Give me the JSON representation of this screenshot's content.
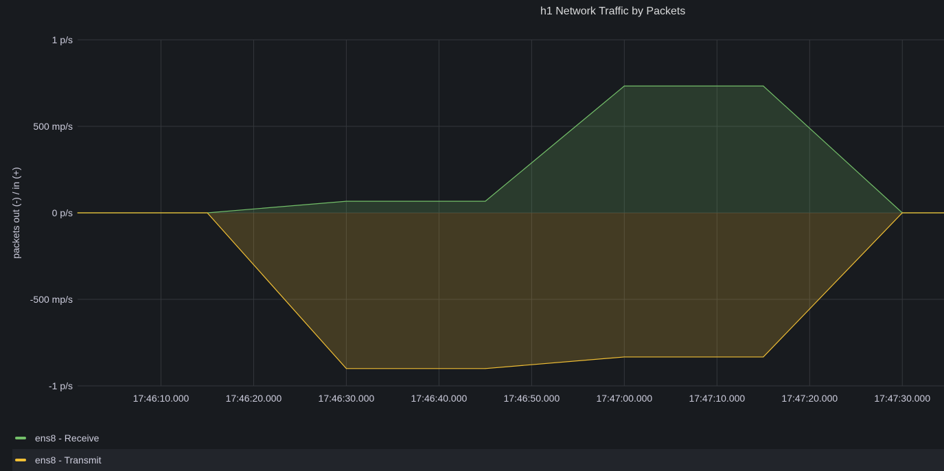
{
  "panel": {
    "title": "h1 Network Traffic by Packets"
  },
  "colors": {
    "receive": "#73bf69",
    "transmit": "#f2c035",
    "grid": "#34373c",
    "text": "#ccccdc"
  },
  "chart_data": {
    "type": "area",
    "title": "h1 Network Traffic by Packets",
    "ylabel": "packets out (-) / in (+)",
    "ylim": [
      -1,
      1
    ],
    "y_ticks": [
      1,
      0.5,
      0,
      -0.5,
      -1
    ],
    "y_tick_labels": [
      "1 p/s",
      "500 mp/s",
      "0 p/s",
      "-500 mp/s",
      "-1 p/s"
    ],
    "x_ticks": [
      "17:46:10.000",
      "17:46:20.000",
      "17:46:30.000",
      "17:46:40.000",
      "17:46:50.000",
      "17:47:00.000",
      "17:47:10.000",
      "17:47:20.000",
      "17:47:30.000"
    ],
    "x_tick_times": [
      "17:46:10",
      "17:46:20",
      "17:46:30",
      "17:46:40",
      "17:46:50",
      "17:47:00",
      "17:47:10",
      "17:47:20",
      "17:47:30"
    ],
    "xlim": [
      "17:46:01",
      "17:47:34.5"
    ],
    "grid": true,
    "legend": "bottom-left",
    "series": [
      {
        "name": "ens8 - Receive",
        "x": [
          "17:46:01",
          "17:46:15",
          "17:46:30",
          "17:46:45",
          "17:47:00",
          "17:47:15",
          "17:47:30",
          "17:47:34.5"
        ],
        "values": [
          0,
          0,
          0.067,
          0.067,
          0.733,
          0.733,
          0,
          0
        ]
      },
      {
        "name": "ens8 - Transmit",
        "x": [
          "17:46:01",
          "17:46:15",
          "17:46:30",
          "17:46:45",
          "17:47:00",
          "17:47:15",
          "17:47:30",
          "17:47:34.5"
        ],
        "values": [
          0,
          0,
          -0.9,
          -0.9,
          -0.833,
          -0.833,
          0,
          0
        ]
      }
    ]
  }
}
